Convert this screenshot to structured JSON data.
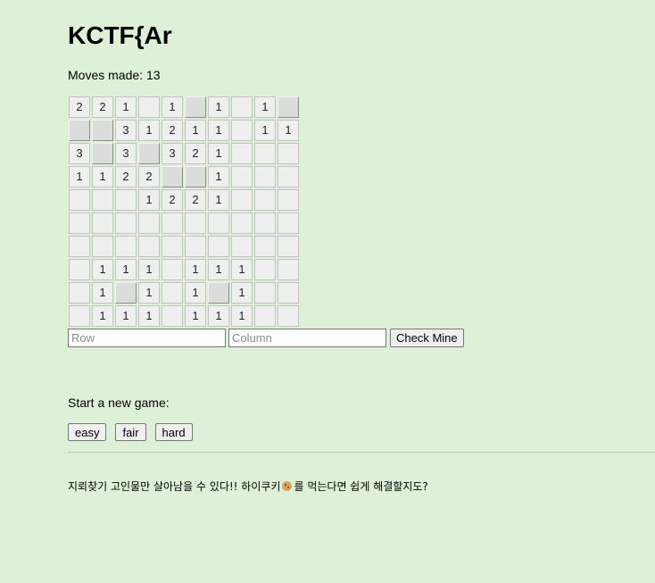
{
  "title": "KCTF{Ar",
  "moves": {
    "label": "Moves made:",
    "count": "13"
  },
  "board": [
    [
      "2",
      "2",
      "1",
      "",
      "1",
      "#",
      "1",
      "",
      "1",
      "#"
    ],
    [
      "#",
      "#",
      "3",
      "1",
      "2",
      "1",
      "1",
      "",
      "1",
      "1"
    ],
    [
      "3",
      "#",
      "3",
      "#",
      "3",
      "2",
      "1",
      "",
      "",
      ""
    ],
    [
      "1",
      "1",
      "2",
      "2",
      "#",
      "#",
      "1",
      "",
      "",
      ""
    ],
    [
      "",
      "",
      "",
      "1",
      "2",
      "2",
      "1",
      "",
      "",
      ""
    ],
    [
      "",
      "",
      "",
      "",
      "",
      "",
      "",
      "",
      "",
      ""
    ],
    [
      "",
      "",
      "",
      "",
      "",
      "",
      "",
      "",
      "",
      ""
    ],
    [
      "",
      "1",
      "1",
      "1",
      "",
      "1",
      "1",
      "1",
      "",
      ""
    ],
    [
      "",
      "1",
      "#",
      "1",
      "",
      "1",
      "#",
      "1",
      "",
      ""
    ],
    [
      "",
      "1",
      "1",
      "1",
      "",
      "1",
      "1",
      "1",
      "",
      ""
    ]
  ],
  "controls": {
    "row_placeholder": "Row",
    "column_placeholder": "Column",
    "check_label": "Check Mine"
  },
  "new_game": {
    "label": "Start a new game:",
    "levels": [
      "easy",
      "fair",
      "hard"
    ]
  },
  "hint": {
    "before": "지뢰찾기 고인물만 살아남을 수 있다!! 하이쿠키",
    "icon": "cookie-icon",
    "after": "를 먹는다면 쉽게 해결할지도?"
  }
}
